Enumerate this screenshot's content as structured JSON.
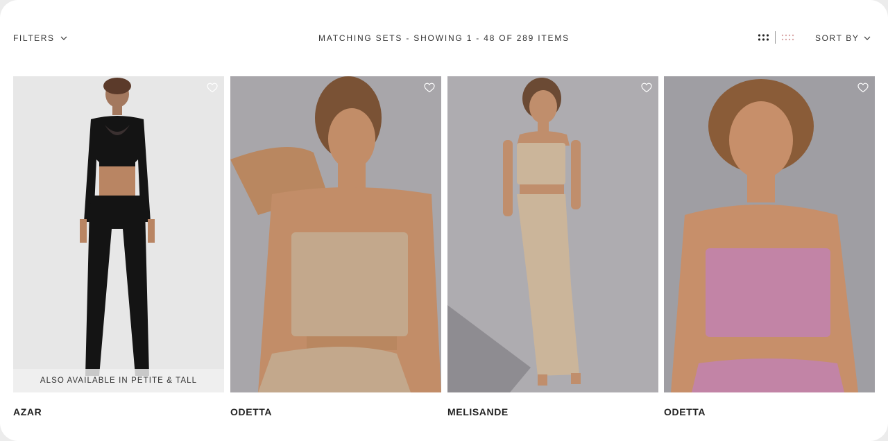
{
  "toolbar": {
    "filters_label": "FILTERS",
    "title": "MATCHING SETS - SHOWING 1 - 48 OF 289 ITEMS",
    "sort_label": "SORT BY"
  },
  "products": [
    {
      "name": "AZAR",
      "badge": "ALSO AVAILABLE IN PETITE & TALL",
      "bg": "#e7e7e7",
      "outfit": "#141414"
    },
    {
      "name": "ODETTA",
      "badge": "",
      "bg": "#a8a6aa",
      "outfit": "#c3a88c"
    },
    {
      "name": "MELISANDE",
      "badge": "",
      "bg": "#aeacb0",
      "outfit": "#cbb59a"
    },
    {
      "name": "ODETTA",
      "badge": "",
      "bg": "#9f9ea3",
      "outfit": "#c284a6"
    }
  ],
  "icons": {
    "filters": "chevron-down-icon",
    "sort": "chevron-down-icon",
    "wishlist": "heart-icon",
    "grid_small": "grid-4-icon",
    "grid_large": "grid-8-icon"
  }
}
